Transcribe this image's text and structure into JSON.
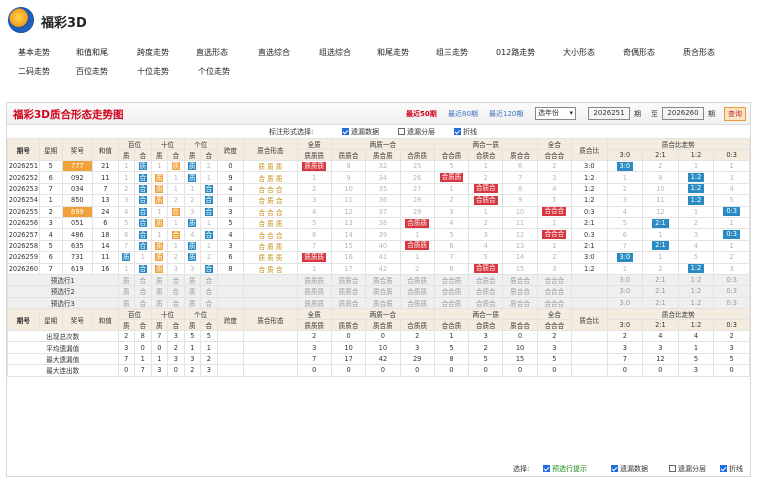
{
  "site": {
    "title": "福彩3D"
  },
  "nav": {
    "row1": [
      "基本走势",
      "和值和尾",
      "跨度走势",
      "直选形态",
      "直选综合",
      "组选综合",
      "和尾走势",
      "组三走势",
      "012路走势",
      "大小形态",
      "奇偶形态",
      "质合形态"
    ],
    "row2": [
      "二码走势",
      "百位走势",
      "十位走势",
      "个位走势"
    ]
  },
  "panel": {
    "title": "福彩3D质合形态走势图",
    "periods": [
      "最近50期",
      "最近80期",
      "最近120期"
    ],
    "select_value": "选年份",
    "start": "2026251",
    "start_suffix": "期",
    "to": "至",
    "end": "2026260",
    "end_suffix": "期",
    "query": "查询"
  },
  "options": {
    "label": "标注形式选择:",
    "items": [
      "遗漏数据",
      "遗漏分层",
      "折线"
    ],
    "checked": [
      true,
      false,
      true
    ]
  },
  "headers": {
    "issue": "期号",
    "week": "星期",
    "award": "奖号",
    "sum": "和值",
    "pos": [
      "百位",
      "十位",
      "个位"
    ],
    "zh": [
      "质",
      "合"
    ],
    "span": "跨度",
    "shape": "质合形态",
    "all_zhi": "全质",
    "two_zhi": "两质一合",
    "two_he": "两合一质",
    "all_he": "全合",
    "ratio": "质合比",
    "ratio_trend": "质合比走势",
    "patterns_all": "质质质",
    "patterns_2z": [
      "质质合",
      "质合质",
      "合质质"
    ],
    "patterns_2h": [
      "合合质",
      "合质合",
      "质合合"
    ],
    "patterns_ah": "合合合",
    "ratios": [
      "3:0",
      "2:1",
      "1:2",
      "0:3"
    ]
  },
  "rows": [
    {
      "issue": "2026251",
      "week": "5",
      "award": "777",
      "sum": "21",
      "pos": [
        [
          "1",
          "质"
        ],
        [
          "1",
          "质"
        ],
        [
          "质",
          "2"
        ]
      ],
      "span": "0",
      "shape": "质 质 质",
      "allz": "质质质",
      "z2": [
        "8",
        "32",
        "25"
      ],
      "h2": [
        "5",
        "1",
        "6"
      ],
      "ah": "2",
      "ratio": "3:0",
      "rt": [
        "3:0",
        "2",
        "1",
        "1"
      ],
      "hl": [
        0,
        0
      ]
    },
    {
      "issue": "2026252",
      "week": "6",
      "award": "092",
      "sum": "11",
      "pos": [
        [
          "1",
          "合"
        ],
        [
          "质",
          "1"
        ],
        [
          "质",
          "1"
        ]
      ],
      "span": "9",
      "shape": "合 质 质",
      "allz": "1",
      "z2": [
        "9",
        "34",
        "26"
      ],
      "h2": [
        "合质质",
        "2",
        "7"
      ],
      "ah": "3",
      "ratio": "1:2",
      "rt": [
        "1",
        "9",
        "1:2",
        "3"
      ]
    },
    {
      "issue": "2026253",
      "week": "7",
      "award": "034",
      "sum": "7",
      "pos": [
        [
          "2",
          "合"
        ],
        [
          "质",
          "1"
        ],
        [
          "1",
          "合"
        ]
      ],
      "span": "4",
      "shape": "合 合 合",
      "allz": "2",
      "z2": [
        "10",
        "35",
        "27"
      ],
      "h2": [
        "1",
        "合质合",
        "8"
      ],
      "ah": "4",
      "ratio": "1:2",
      "rt": [
        "2",
        "10",
        "1:2",
        "4"
      ]
    },
    {
      "issue": "2026254",
      "week": "1",
      "award": "850",
      "sum": "13",
      "pos": [
        [
          "3",
          "合"
        ],
        [
          "质",
          "2"
        ],
        [
          "2",
          "合"
        ]
      ],
      "span": "8",
      "shape": "合 质 合",
      "allz": "3",
      "z2": [
        "11",
        "36",
        "28"
      ],
      "h2": [
        "2",
        "合质合",
        "9"
      ],
      "ah": "5",
      "ratio": "1:2",
      "rt": [
        "3",
        "11",
        "1:2",
        "5"
      ]
    },
    {
      "issue": "2026255",
      "week": "2",
      "award": "699",
      "sum": "24",
      "pos": [
        [
          "4",
          "合"
        ],
        [
          "1",
          "合"
        ],
        [
          "3",
          "合"
        ]
      ],
      "span": "3",
      "shape": "合 合 合",
      "allz": "4",
      "z2": [
        "12",
        "37",
        "29"
      ],
      "h2": [
        "3",
        "1",
        "10"
      ],
      "ah": "合合合",
      "ratio": "0:3",
      "rt": [
        "4",
        "12",
        "1",
        "0:3"
      ]
    },
    {
      "issue": "2026256",
      "week": "3",
      "award": "051",
      "sum": "6",
      "pos": [
        [
          "5",
          "合"
        ],
        [
          "质",
          "1"
        ],
        [
          "质",
          "1"
        ]
      ],
      "span": "5",
      "shape": "合 质 质",
      "allz": "5",
      "z2": [
        "13",
        "38",
        "合质质"
      ],
      "h2": [
        "4",
        "2",
        "11"
      ],
      "ah": "1",
      "ratio": "2:1",
      "rt": [
        "5",
        "2:1",
        "2",
        "1"
      ]
    },
    {
      "issue": "2026257",
      "week": "4",
      "award": "486",
      "sum": "18",
      "pos": [
        [
          "6",
          "合"
        ],
        [
          "1",
          "合"
        ],
        [
          "4",
          "合"
        ]
      ],
      "span": "4",
      "shape": "合 合 合",
      "allz": "6",
      "z2": [
        "14",
        "39",
        "1"
      ],
      "h2": [
        "5",
        "3",
        "12"
      ],
      "ah": "合合合",
      "ratio": "0:3",
      "rt": [
        "6",
        "1",
        "3",
        "0:3"
      ]
    },
    {
      "issue": "2026258",
      "week": "5",
      "award": "635",
      "sum": "14",
      "pos": [
        [
          "7",
          "合"
        ],
        [
          "质",
          "1"
        ],
        [
          "质",
          "1"
        ]
      ],
      "span": "3",
      "shape": "合 质 质",
      "allz": "7",
      "z2": [
        "15",
        "40",
        "合质质"
      ],
      "h2": [
        "6",
        "4",
        "13"
      ],
      "ah": "1",
      "ratio": "2:1",
      "rt": [
        "7",
        "2:1",
        "4",
        "1"
      ]
    },
    {
      "issue": "2026259",
      "week": "6",
      "award": "731",
      "sum": "11",
      "pos": [
        [
          "质",
          "1"
        ],
        [
          "质",
          "2"
        ],
        [
          "质",
          "2"
        ]
      ],
      "span": "6",
      "shape": "质 质 质",
      "allz": "质质质",
      "z2": [
        "16",
        "41",
        "1"
      ],
      "h2": [
        "7",
        "5",
        "14"
      ],
      "ah": "2",
      "ratio": "3:0",
      "rt": [
        "3:0",
        "1",
        "5",
        "2"
      ]
    },
    {
      "issue": "2026260",
      "week": "7",
      "award": "619",
      "sum": "16",
      "pos": [
        [
          "1",
          "合"
        ],
        [
          "质",
          "3"
        ],
        [
          "3",
          "合"
        ]
      ],
      "span": "8",
      "shape": "合 质 合",
      "allz": "1",
      "z2": [
        "17",
        "42",
        "2"
      ],
      "h2": [
        "8",
        "合质合",
        "15"
      ],
      "ah": "3",
      "ratio": "1:2",
      "rt": [
        "1",
        "2",
        "1:2",
        "3"
      ]
    }
  ],
  "predict": {
    "labels": [
      "预选行1",
      "预选行2",
      "预选行3"
    ],
    "zh": [
      "质",
      "合"
    ],
    "pats": [
      "质质质",
      "质质合",
      "质合质",
      "合质质",
      "合合质",
      "合质合",
      "质合合",
      "合合合"
    ],
    "ratios": [
      "3:0",
      "2:1",
      "1:2",
      "0:3"
    ]
  },
  "stats": [
    {
      "label": "出现总次数",
      "pos": [
        "2",
        "8",
        "7",
        "3",
        "5",
        "5"
      ],
      "allz": "2",
      "z2": [
        "0",
        "0",
        "2"
      ],
      "h2": [
        "1",
        "3",
        "0"
      ],
      "ah": "2",
      "rt": [
        "2",
        "4",
        "4",
        "2"
      ]
    },
    {
      "label": "平均遗漏值",
      "pos": [
        "3",
        "0",
        "0",
        "2",
        "1",
        "1"
      ],
      "allz": "3",
      "z2": [
        "10",
        "10",
        "3"
      ],
      "h2": [
        "5",
        "2",
        "10"
      ],
      "ah": "3",
      "rt": [
        "3",
        "3",
        "1",
        "3"
      ]
    },
    {
      "label": "最大遗漏值",
      "pos": [
        "7",
        "1",
        "1",
        "3",
        "3",
        "2"
      ],
      "allz": "7",
      "z2": [
        "17",
        "42",
        "29"
      ],
      "h2": [
        "8",
        "5",
        "15"
      ],
      "ah": "5",
      "rt": [
        "7",
        "12",
        "5",
        "5"
      ]
    },
    {
      "label": "最大连出数",
      "pos": [
        "0",
        "7",
        "3",
        "0",
        "2",
        "3"
      ],
      "allz": "0",
      "z2": [
        "0",
        "0",
        "0"
      ],
      "h2": [
        "0",
        "0",
        "0"
      ],
      "ah": "0",
      "rt": [
        "0",
        "0",
        "3",
        "0"
      ]
    }
  ],
  "footer": {
    "label": "选择:",
    "items": [
      "预选行提示",
      "遗漏数据",
      "遗漏分层",
      "折线"
    ],
    "checked": [
      true,
      true,
      false,
      true
    ]
  }
}
